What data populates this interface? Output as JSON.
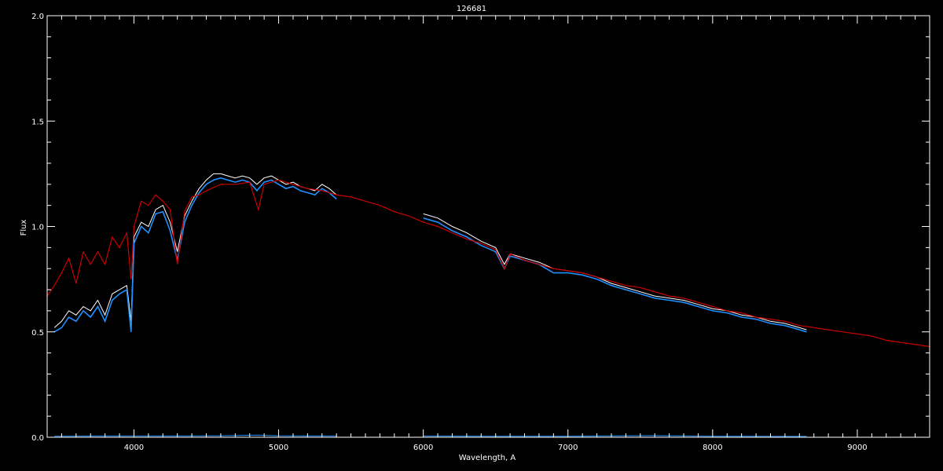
{
  "chart_data": {
    "type": "line",
    "title": "126681",
    "xlabel": "Wavelength, A",
    "ylabel": "Flux",
    "xlim": [
      3400,
      9500
    ],
    "ylim": [
      0.0,
      2.0
    ],
    "xticks": [
      4000,
      5000,
      6000,
      7000,
      8000,
      9000
    ],
    "xtick_labels": [
      "4000",
      "5000",
      "6000",
      "7000",
      "8000",
      "9000"
    ],
    "yticks": [
      0.0,
      0.5,
      1.0,
      1.5,
      2.0
    ],
    "ytick_labels": [
      "0.0",
      "0.5",
      "1.0",
      "1.5",
      "2.0"
    ],
    "grid": false,
    "legend": "none",
    "colors": {
      "background": "#000000",
      "axes": "#ffffff",
      "observed": "#ffffff",
      "observed_smoothed": "#1e90ff",
      "model": "#cc0000",
      "error": "#1e90ff"
    },
    "series": [
      {
        "key": "observed",
        "segments": [
          {
            "x": [
              3450,
              3500,
              3550,
              3600,
              3650,
              3700,
              3750,
              3800,
              3850,
              3900,
              3950,
              3980,
              4000,
              4050,
              4100,
              4150,
              4200,
              4250,
              4300,
              4350,
              4400,
              4450,
              4500,
              4550,
              4600,
              4650,
              4700,
              4750,
              4800,
              4850,
              4900,
              4950,
              5000,
              5050,
              5100,
              5150,
              5200,
              5250,
              5300,
              5350,
              5400
            ],
            "y": [
              0.52,
              0.55,
              0.6,
              0.58,
              0.62,
              0.6,
              0.65,
              0.58,
              0.68,
              0.7,
              0.72,
              0.55,
              0.95,
              1.02,
              1.0,
              1.08,
              1.1,
              1.02,
              0.88,
              1.05,
              1.12,
              1.18,
              1.22,
              1.25,
              1.25,
              1.24,
              1.23,
              1.24,
              1.23,
              1.2,
              1.23,
              1.24,
              1.22,
              1.2,
              1.21,
              1.19,
              1.18,
              1.17,
              1.2,
              1.18,
              1.15
            ]
          },
          {
            "x": [
              6000,
              6100,
              6200,
              6300,
              6400,
              6500,
              6560,
              6600,
              6700,
              6800,
              6900,
              7000,
              7100,
              7200,
              7300,
              7400,
              7500,
              7600,
              7700,
              7800,
              7900,
              8000,
              8100,
              8200,
              8300,
              8400,
              8500,
              8600,
              8650
            ],
            "y": [
              1.06,
              1.04,
              1.0,
              0.97,
              0.93,
              0.9,
              0.82,
              0.87,
              0.85,
              0.83,
              0.8,
              0.79,
              0.78,
              0.76,
              0.73,
              0.71,
              0.69,
              0.67,
              0.66,
              0.65,
              0.63,
              0.61,
              0.6,
              0.58,
              0.57,
              0.55,
              0.54,
              0.52,
              0.51
            ]
          }
        ]
      },
      {
        "key": "observed_smoothed",
        "segments": [
          {
            "x": [
              3450,
              3500,
              3550,
              3600,
              3650,
              3700,
              3750,
              3800,
              3850,
              3900,
              3950,
              3980,
              4000,
              4050,
              4100,
              4150,
              4200,
              4250,
              4300,
              4350,
              4400,
              4450,
              4500,
              4550,
              4600,
              4650,
              4700,
              4750,
              4800,
              4850,
              4900,
              4950,
              5000,
              5050,
              5100,
              5150,
              5200,
              5250,
              5300,
              5350,
              5400
            ],
            "y": [
              0.5,
              0.52,
              0.57,
              0.55,
              0.6,
              0.57,
              0.62,
              0.55,
              0.65,
              0.68,
              0.7,
              0.5,
              0.92,
              1.0,
              0.97,
              1.06,
              1.07,
              0.98,
              0.84,
              1.02,
              1.1,
              1.16,
              1.2,
              1.22,
              1.23,
              1.22,
              1.21,
              1.22,
              1.21,
              1.17,
              1.21,
              1.22,
              1.2,
              1.18,
              1.19,
              1.17,
              1.16,
              1.15,
              1.18,
              1.16,
              1.13
            ]
          },
          {
            "x": [
              6000,
              6100,
              6200,
              6300,
              6400,
              6500,
              6560,
              6600,
              6700,
              6800,
              6900,
              7000,
              7100,
              7200,
              7300,
              7400,
              7500,
              7600,
              7700,
              7800,
              7900,
              8000,
              8100,
              8200,
              8300,
              8400,
              8500,
              8600,
              8650
            ],
            "y": [
              1.04,
              1.02,
              0.98,
              0.95,
              0.91,
              0.88,
              0.8,
              0.86,
              0.84,
              0.82,
              0.78,
              0.78,
              0.77,
              0.75,
              0.72,
              0.7,
              0.68,
              0.66,
              0.65,
              0.64,
              0.62,
              0.6,
              0.59,
              0.57,
              0.56,
              0.54,
              0.53,
              0.51,
              0.5
            ]
          }
        ]
      },
      {
        "key": "model",
        "segments": [
          {
            "x": [
              3400,
              3450,
              3500,
              3550,
              3600,
              3650,
              3700,
              3750,
              3800,
              3850,
              3900,
              3950,
              3980,
              4000,
              4050,
              4100,
              4150,
              4200,
              4250,
              4300,
              4350,
              4400,
              4450,
              4500,
              4600,
              4700,
              4800,
              4860,
              4900,
              5000,
              5100,
              5200,
              5300,
              5400,
              5500,
              5600,
              5700,
              5800,
              5900,
              6000,
              6100,
              6200,
              6300,
              6400,
              6500,
              6562,
              6600,
              6700,
              6800,
              6900,
              7000,
              7100,
              7200,
              7300,
              7400,
              7500,
              7600,
              7700,
              7800,
              7900,
              8000,
              8100,
              8200,
              8300,
              8400,
              8500,
              8600,
              8700,
              8800,
              8900,
              9000,
              9100,
              9200,
              9300,
              9400,
              9500
            ],
            "y": [
              0.67,
              0.72,
              0.78,
              0.85,
              0.73,
              0.88,
              0.82,
              0.88,
              0.82,
              0.95,
              0.9,
              0.97,
              0.75,
              1.0,
              1.12,
              1.1,
              1.15,
              1.12,
              1.08,
              0.82,
              1.07,
              1.14,
              1.15,
              1.17,
              1.2,
              1.2,
              1.21,
              1.08,
              1.2,
              1.22,
              1.2,
              1.18,
              1.17,
              1.15,
              1.14,
              1.12,
              1.1,
              1.07,
              1.05,
              1.02,
              1.0,
              0.97,
              0.94,
              0.92,
              0.89,
              0.8,
              0.87,
              0.84,
              0.82,
              0.8,
              0.79,
              0.78,
              0.76,
              0.74,
              0.72,
              0.71,
              0.69,
              0.67,
              0.66,
              0.64,
              0.62,
              0.6,
              0.59,
              0.57,
              0.56,
              0.55,
              0.53,
              0.52,
              0.51,
              0.5,
              0.49,
              0.48,
              0.46,
              0.45,
              0.44,
              0.43
            ]
          }
        ]
      },
      {
        "key": "error",
        "segments": [
          {
            "x": [
              3450,
              3800,
              4200,
              4600,
              4860,
              5000,
              5400
            ],
            "y": [
              0.005,
              0.006,
              0.006,
              0.007,
              0.01,
              0.007,
              0.006
            ]
          },
          {
            "x": [
              6000,
              6500,
              7000,
              7600,
              8000,
              8650
            ],
            "y": [
              0.006,
              0.005,
              0.005,
              0.008,
              0.005,
              0.004
            ]
          }
        ]
      }
    ]
  }
}
